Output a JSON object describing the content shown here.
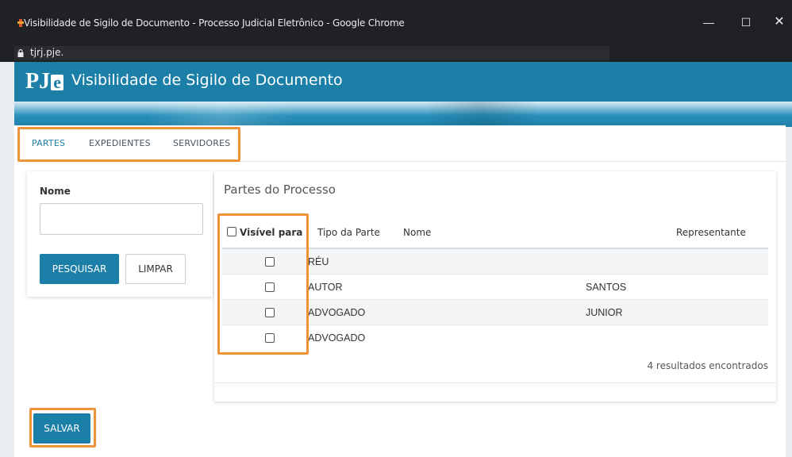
{
  "window": {
    "title": "Visibilidade de Sigilo de Documento - Processo Judicial Eletrônico - Google Chrome",
    "url": "tjrj.pje.",
    "minimize": "—",
    "maximize": "☐",
    "close": "✕"
  },
  "app": {
    "logo_p": "P",
    "logo_j": "J",
    "logo_e": "e",
    "title": "Visibilidade de Sigilo de Documento"
  },
  "tabs": [
    {
      "label": "PARTES",
      "active": true
    },
    {
      "label": "EXPEDIENTES",
      "active": false
    },
    {
      "label": "SERVIDORES",
      "active": false
    }
  ],
  "search": {
    "name_label": "Nome",
    "name_value": "",
    "search_button": "PESQUISAR",
    "clear_button": "LIMPAR"
  },
  "results": {
    "title": "Partes do Processo",
    "columns": {
      "visible": "Visível para",
      "type": "Tipo da Parte",
      "name": "Nome",
      "representative": "Representante"
    },
    "rows": [
      {
        "type": "RÉU",
        "name": "",
        "representative": ""
      },
      {
        "type": "AUTOR",
        "name": "",
        "representative": "SANTOS"
      },
      {
        "type": "ADVOGADO",
        "name": "",
        "representative": "JUNIOR"
      },
      {
        "type": "ADVOGADO",
        "name": "",
        "representative": ""
      }
    ],
    "count_text": "4 resultados encontrados"
  },
  "save_button": "SALVAR",
  "colors": {
    "brand": "#1c7fa8",
    "highlight": "#f0923a"
  }
}
